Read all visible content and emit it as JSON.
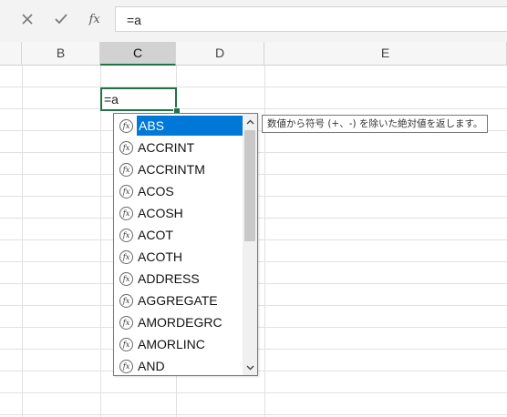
{
  "formula_bar": {
    "cancel_icon": "close-icon",
    "enter_icon": "check-icon",
    "insert_function_label": "fx",
    "formula": "=a"
  },
  "columns": [
    "B",
    "C",
    "D",
    "E"
  ],
  "selected_column": "C",
  "active_cell": {
    "value": "=a"
  },
  "autocomplete": {
    "items": [
      {
        "icon": "function-icon",
        "label": "ABS"
      },
      {
        "icon": "function-icon",
        "label": "ACCRINT"
      },
      {
        "icon": "function-icon",
        "label": "ACCRINTM"
      },
      {
        "icon": "function-icon",
        "label": "ACOS"
      },
      {
        "icon": "function-icon",
        "label": "ACOSH"
      },
      {
        "icon": "function-icon",
        "label": "ACOT"
      },
      {
        "icon": "function-icon",
        "label": "ACOTH"
      },
      {
        "icon": "function-icon",
        "label": "ADDRESS"
      },
      {
        "icon": "function-icon",
        "label": "AGGREGATE"
      },
      {
        "icon": "function-icon",
        "label": "AMORDEGRC"
      },
      {
        "icon": "function-icon",
        "label": "AMORLINC"
      },
      {
        "icon": "function-icon",
        "label": "AND"
      }
    ],
    "selected_index": 0,
    "icon_glyph": "fx"
  },
  "tooltip": {
    "text": "数値から符号 (+、-) を除いた絶対値を返します。"
  },
  "colors": {
    "accent": "#217346",
    "selection": "#0078d7"
  }
}
